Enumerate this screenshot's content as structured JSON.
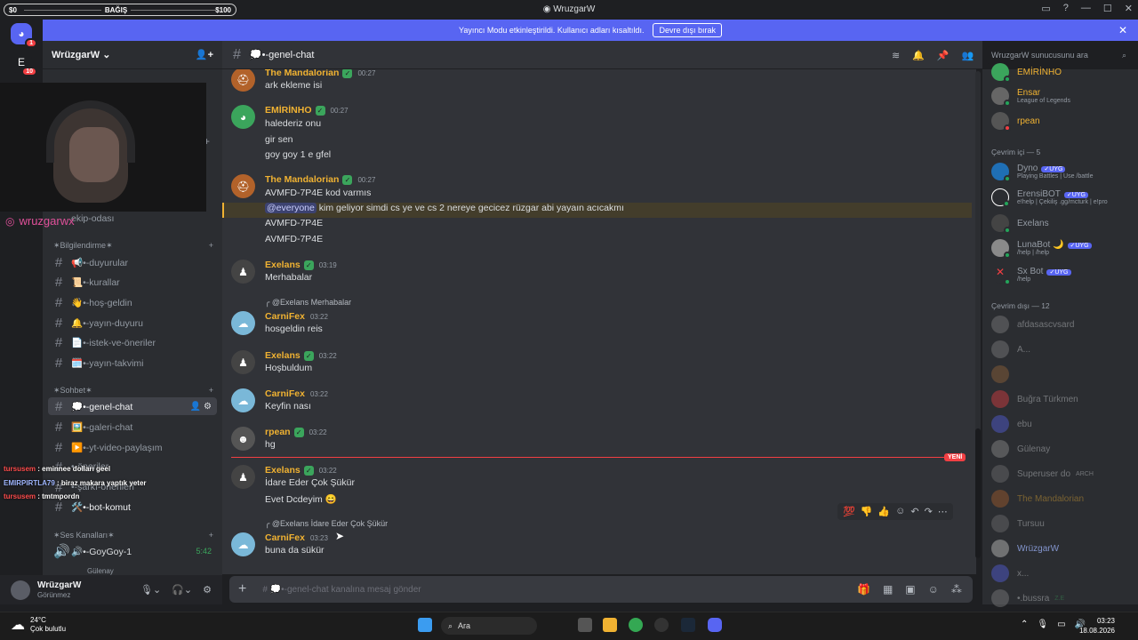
{
  "titlebar": {
    "donation_left": "$0",
    "donation_label": "BAĞIŞ",
    "donation_right": "$100",
    "window_title": "WruzgarW"
  },
  "banner": {
    "text": "Yayıncı Modu etkinleştirildi. Kullanıcı adları kısaltıldı.",
    "button": "Devre dışı bırak"
  },
  "rail": {
    "badge1": "1",
    "badge2": "10"
  },
  "guild": {
    "name": "WrüzgarW"
  },
  "webcam": {
    "handle": "wruzgarwx"
  },
  "sidebar": {
    "partial_channel": "ekip-odası",
    "cat_info": "✶Bilgilendirme✶",
    "info_channels": [
      "📢•-duyurular",
      "📜•-kurallar",
      "👋•-hoş-geldin",
      "🔔•-yayın-duyuru",
      "📄•-istek-ve-öneriler",
      "🗓️•-yayın-takvimi"
    ],
    "cat_chat": "✶Sohbet✶",
    "chat_channels": [
      "💭•-genel-chat",
      "🖼️•-galeri-chat",
      "▶️•-yt-video-paylaşım",
      "•-öneriler",
      "•-şarkı-önerileri",
      "🛠️•-bot-komut"
    ],
    "cat_voice": "✶Ses Kanalları✶",
    "voice_channel": "🔊•-GoyGoy-1",
    "voice_time": "5:42",
    "voice_member": "Gülenay"
  },
  "overlay": [
    {
      "user": "tursusem",
      "text": " : eminnee dolları geel"
    },
    {
      "user": "EMIRPIRTLA79",
      "text": " : biraz makara yaptık yeter"
    },
    {
      "user": "tursusem",
      "text": " : tmtmpordn"
    }
  ],
  "user": {
    "name": "WrüzgarW",
    "status": "Görünmez"
  },
  "channel": {
    "name": "💭•-genel-chat",
    "search_placeholder": "WruzgarW sunucusunu ara",
    "composer_placeholder": "# 💭•-genel-chat kanalına mesaj gönder"
  },
  "messages": {
    "m1": {
      "name": "The Mandalorian",
      "time": "00:27",
      "lines": [
        "ark ekleme isi"
      ]
    },
    "m2": {
      "name": "EMİRİNHO",
      "time": "00:27",
      "lines": [
        "halederiz onu",
        "gir sen",
        "goy goy 1 e gfel"
      ]
    },
    "m3": {
      "name": "The Mandalorian",
      "time": "00:27",
      "lines": [
        "AVMFD-7P4E kod varmıs",
        "kim geliyor simdi cs ye ve cs 2 nereye gecicez rüzgar abi yayaın acıcakmı",
        "AVMFD-7P4E",
        "AVMFD-7P4E"
      ],
      "mention": "@everyone"
    },
    "m4": {
      "name": "Exelans",
      "time": "03:19",
      "lines": [
        "Merhabalar"
      ]
    },
    "m5": {
      "reply": "@Exelans Merhabalar",
      "name": "CarniFex",
      "time": "03:22",
      "lines": [
        "hosgeldin reis"
      ]
    },
    "m6": {
      "name": "Exelans",
      "time": "03:22",
      "lines": [
        "Hoşbuldum"
      ]
    },
    "m7": {
      "name": "CarniFex",
      "time": "03:22",
      "lines": [
        "Keyfin nası"
      ]
    },
    "m8": {
      "name": "rpean",
      "time": "03:22",
      "lines": [
        "hg"
      ]
    },
    "new_label": "YENİ",
    "m9": {
      "name": "Exelans",
      "time": "03:22",
      "lines": [
        "İdare Eder Çok Şükür",
        "Evet Dcdeyim 😄"
      ]
    },
    "m10": {
      "reply": "@Exelans İdare Eder Çok Şükür",
      "name": "CarniFex",
      "time": "03:23",
      "lines": [
        "buna da sükür"
      ]
    }
  },
  "members": {
    "top": [
      {
        "name": "EMİRİNHO",
        "color": "#f0b232"
      },
      {
        "name": "Ensar",
        "sub": "League of Legends",
        "color": "#f0b232"
      },
      {
        "name": "rpean",
        "color": "#f0b232"
      }
    ],
    "online_header": "Çevrim içi — 5",
    "online": [
      {
        "name": "Dyno",
        "sub": "Playing Battles | Use /battle",
        "bot": "✓UYG"
      },
      {
        "name": "ErensiBOT",
        "sub": "e!help | Çekiliş .gg/mcturk | e!pro",
        "bot": "✓UYG"
      },
      {
        "name": "Exelans",
        "sub": ""
      },
      {
        "name": "LunaBot 🌙",
        "sub": "/help | /help",
        "bot": "✓UYG"
      },
      {
        "name": "Sx Bot",
        "sub": "/help",
        "bot": "✓UYG"
      }
    ],
    "offline_header": "Çevrim dışı — 12",
    "offline": [
      "afdasascvsard",
      "A...",
      "",
      "Buğra Türkmen",
      "ebu",
      "Gülenay",
      "Superuser do",
      "The Mandalorian",
      "Tursuu",
      "WrüzgarW",
      "x...",
      "•.bussra"
    ],
    "arch_tag": "ARCH",
    "bussra_tag": "Z.E"
  },
  "taskbar": {
    "temp": "24°C",
    "weather": "Çok bulutlu",
    "search": "Ara",
    "time": "03:23",
    "date": "18.08.2026"
  },
  "colors": {
    "accent": "#5865f2",
    "gold": "#f0b232",
    "green": "#3ba55c",
    "red": "#f23f43"
  }
}
